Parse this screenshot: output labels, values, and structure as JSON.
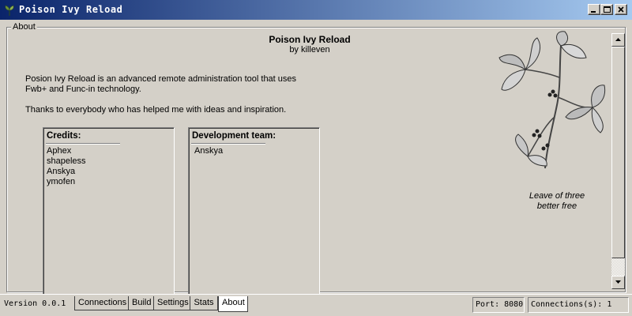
{
  "window": {
    "title": "Poison Ivy Reload",
    "icon": "ivy-leaf-icon"
  },
  "about": {
    "group_label": "About",
    "app_title": "Poison Ivy Reload",
    "byline": "by killeven",
    "description": "Posion Ivy Reload is an advanced remote administration tool that uses Fwb+ and Func-in technology.",
    "thanks": "Thanks to everybody who has helped me with ideas and inspiration.",
    "credits": {
      "heading": "Credits:",
      "names": [
        "Aphex",
        "shapeless",
        "Anskya",
        "ymofen"
      ]
    },
    "dev_team": {
      "heading": "Development team:",
      "names": [
        "Anskya"
      ]
    },
    "motto_line1": "Leave of three",
    "motto_line2": "better free"
  },
  "status": {
    "version": "Version 0.0.1",
    "port": "Port: 8080",
    "connections": "Connections(s): 1"
  },
  "tabs": [
    {
      "label": "Connections",
      "active": false
    },
    {
      "label": "Build",
      "active": false
    },
    {
      "label": "Settings",
      "active": false
    },
    {
      "label": "Stats",
      "active": false
    },
    {
      "label": "About",
      "active": true
    }
  ]
}
